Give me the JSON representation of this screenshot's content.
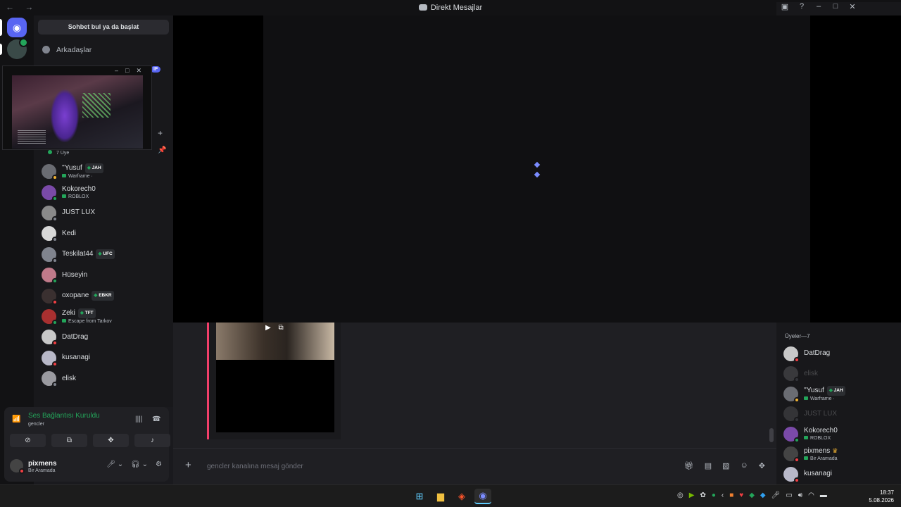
{
  "window": {
    "title": "Direkt Mesajlar",
    "nav_arrows": "← →"
  },
  "sidebar": {
    "search_label": "Sohbet bul ya da başlat",
    "friends_label": "Arkadaşlar",
    "nitro_badge": "IF",
    "member_count": "7 Üye",
    "members": [
      {
        "name": "''Yusuf",
        "tag": "JAH",
        "sub": "Warframe ·",
        "status": "idle",
        "color": "#6a6c72"
      },
      {
        "name": "Kokorech0",
        "tag": "",
        "sub": "ROBLOX",
        "status": "online",
        "color": "#7a4aa8"
      },
      {
        "name": "JUST LUX",
        "tag": "",
        "sub": "",
        "status": "off",
        "color": "#8a8a8a"
      },
      {
        "name": "Kedi",
        "tag": "",
        "sub": "",
        "status": "off",
        "color": "#d8d8d8"
      },
      {
        "name": "Teskilat44",
        "tag": "UFC",
        "sub": "",
        "status": "off",
        "color": "#80848e"
      },
      {
        "name": "Hüseyin",
        "tag": "",
        "sub": "",
        "status": "online",
        "color": "#c07a8a"
      },
      {
        "name": "oxopane",
        "tag": "EBKR",
        "sub": "",
        "status": "dnd",
        "color": "#3a3030"
      },
      {
        "name": "Zeki",
        "tag": "TFT",
        "sub": "Escape from Tarkov",
        "status": "online",
        "color": "#a83030"
      },
      {
        "name": "DatDrag",
        "tag": "",
        "sub": "",
        "status": "dnd",
        "color": "#c8c8c8"
      },
      {
        "name": "kusanagi",
        "tag": "",
        "sub": "",
        "status": "dnd",
        "color": "#b8b8c8"
      },
      {
        "name": "elisk",
        "tag": "",
        "sub": "",
        "status": "off",
        "color": "#9a9aa0"
      }
    ]
  },
  "voice": {
    "status": "Ses Bağlantısı Kuruldu",
    "channel": "gencler"
  },
  "user": {
    "name": "pixmens",
    "status": "Bir Aramada"
  },
  "chat": {
    "placeholder": "gencler kanalına mesaj gönder"
  },
  "right_panel": {
    "header": "Üyeler—7",
    "members": [
      {
        "name": "DatDrag",
        "sub": "",
        "status": "dnd",
        "dim": false,
        "color": "#c8c8c8",
        "crown": false
      },
      {
        "name": "elisk",
        "sub": "",
        "status": "off",
        "dim": true,
        "color": "#9a9aa0",
        "crown": false
      },
      {
        "name": "''Yusuf",
        "tag": "JAH",
        "sub": "Warframe ·",
        "status": "idle",
        "dim": false,
        "color": "#6a6c72",
        "crown": false
      },
      {
        "name": "JUST LUX",
        "sub": "",
        "status": "off",
        "dim": true,
        "color": "#8a8a8a",
        "crown": false
      },
      {
        "name": "Kokorech0",
        "sub": "ROBLOX",
        "status": "online",
        "dim": false,
        "color": "#7a4aa8",
        "crown": false
      },
      {
        "name": "pixmens",
        "sub": "Bir Aramada",
        "status": "dnd",
        "dim": false,
        "color": "#444",
        "crown": true
      },
      {
        "name": "kusanagi",
        "sub": "",
        "status": "dnd",
        "dim": false,
        "color": "#b8b8c8",
        "crown": false
      }
    ]
  },
  "taskbar": {
    "time": "18:37",
    "date": "5.08.2026"
  }
}
